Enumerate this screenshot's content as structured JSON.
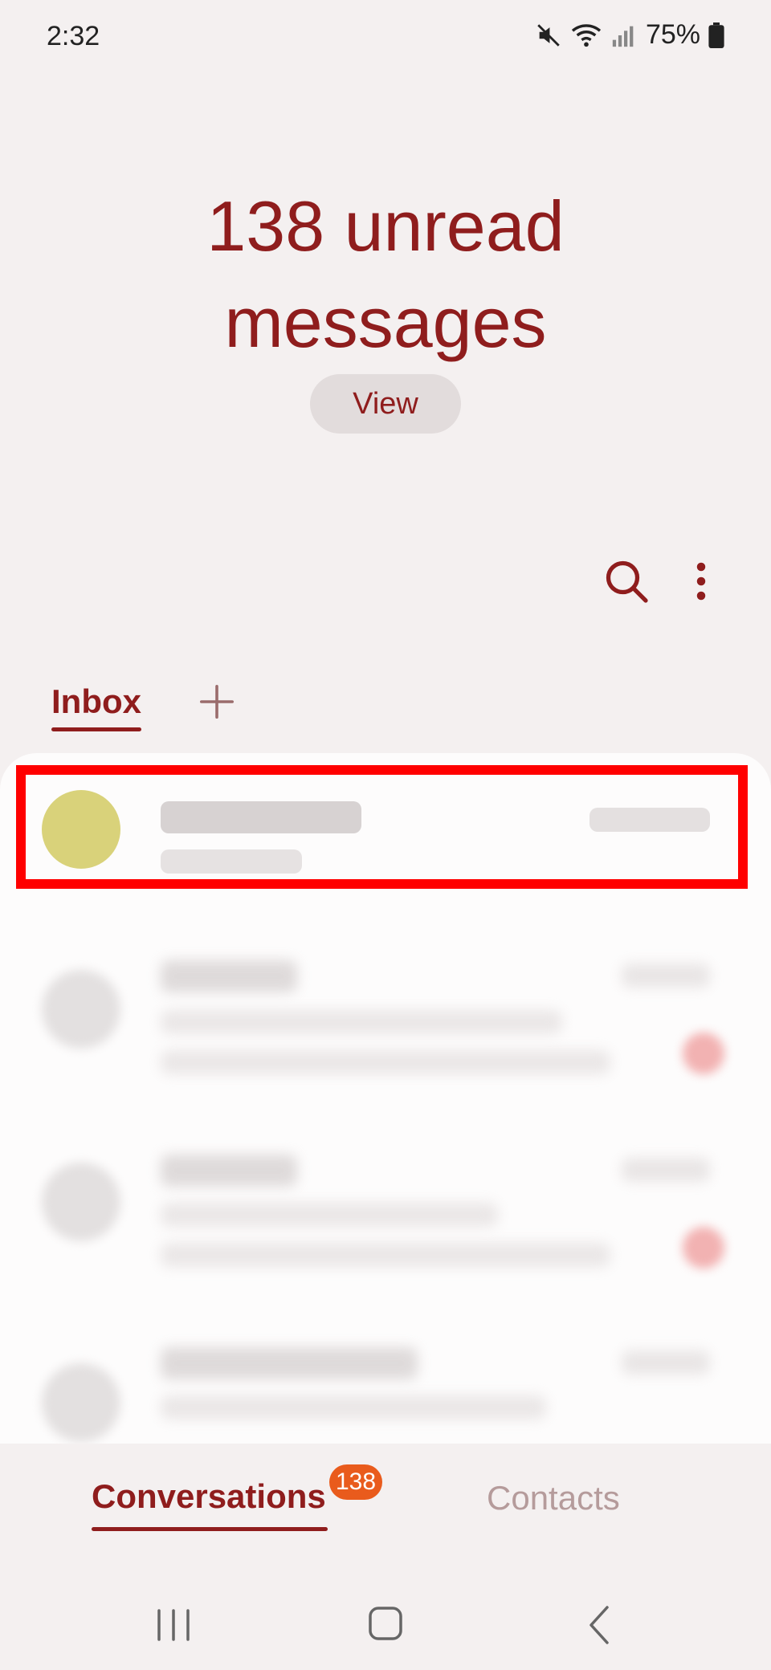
{
  "status": {
    "time": "2:32",
    "battery": "75%"
  },
  "header": {
    "title_line1": "138 unread",
    "title_line2": "messages",
    "view_label": "View"
  },
  "tabs": {
    "inbox_label": "Inbox"
  },
  "bottom_nav": {
    "conversations": "Conversations",
    "badge": "138",
    "contacts": "Contacts"
  },
  "colors": {
    "accent": "#8f1d1d",
    "badge": "#e95b1c",
    "highlight": "#ff0000"
  }
}
